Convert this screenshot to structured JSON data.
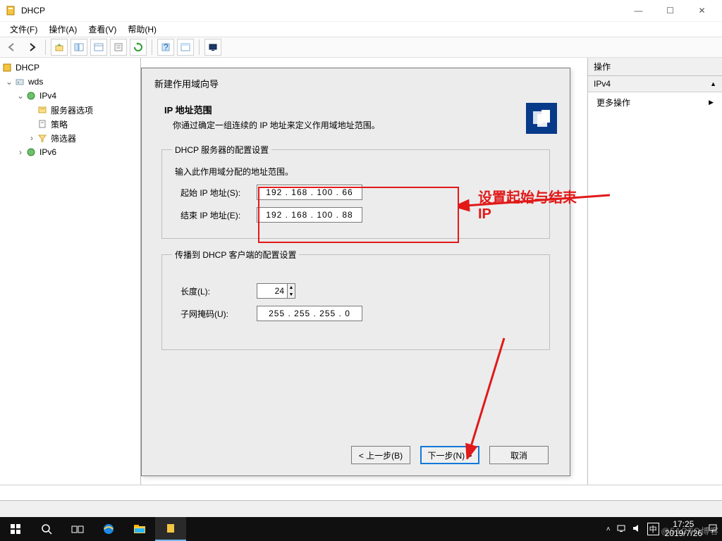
{
  "window": {
    "title": "DHCP",
    "controls": {
      "min": "—",
      "max": "☐",
      "close": "✕"
    }
  },
  "menu": {
    "file": "文件(F)",
    "action": "操作(A)",
    "view": "查看(V)",
    "help": "帮助(H)"
  },
  "tree": {
    "root": "DHCP",
    "server": "wds",
    "ipv4": "IPv4",
    "server_options": "服务器选项",
    "policy": "策略",
    "filter": "筛选器",
    "ipv6": "IPv6"
  },
  "actions": {
    "header": "操作",
    "selected": "IPv4",
    "more": "更多操作"
  },
  "wizard": {
    "title": "新建作用域向导",
    "heading": "IP 地址范围",
    "subheading": "你通过确定一组连续的 IP 地址来定义作用域地址范围。",
    "group_server": "DHCP 服务器的配置设置",
    "enter_range": "输入此作用域分配的地址范围。",
    "start_ip_label": "起始 IP 地址(S):",
    "start_ip": "192 . 168 . 100 .  66",
    "end_ip_label": "结束 IP 地址(E):",
    "end_ip": "192 . 168 . 100 .  88",
    "group_client": "传播到 DHCP 客户端的配置设置",
    "length_label": "长度(L):",
    "length_value": "24",
    "mask_label": "子网掩码(U):",
    "mask_value": "255 . 255 . 255 .   0",
    "btn_back": "< 上一步(B)",
    "btn_next": "下一步(N) >",
    "btn_cancel": "取消"
  },
  "annotation": {
    "text": "设置起始与结束IP"
  },
  "taskbar": {
    "clock_time": "17:25",
    "clock_date": "2019/7/26",
    "ime": "中"
  },
  "watermark": "@51CTO博客"
}
